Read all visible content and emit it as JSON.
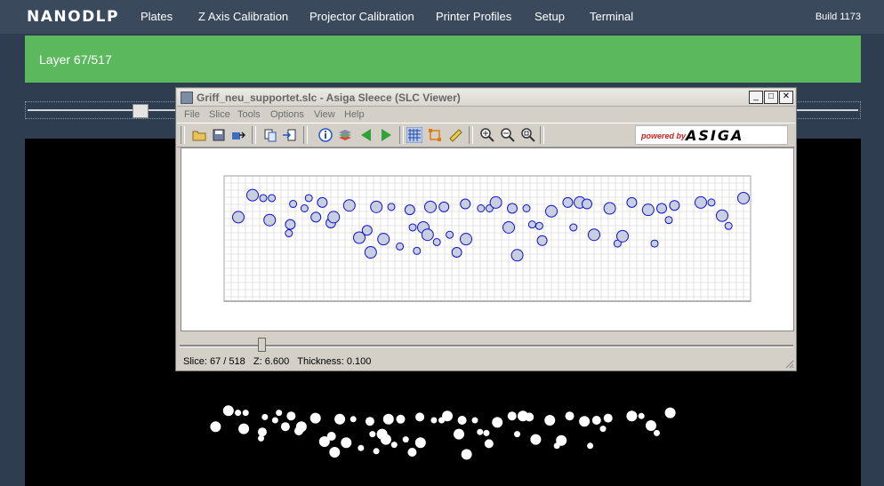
{
  "app": {
    "logo": "NANODLP",
    "build": "Build 1173",
    "nav": [
      "Plates",
      "Z Axis Calibration",
      "Projector Calibration",
      "Printer Profiles",
      "Setup",
      "Terminal"
    ]
  },
  "layer": {
    "label": "Layer 67/517",
    "slider_fraction": 0.13
  },
  "viewer": {
    "title": "Griff_neu_supportet.slc - Asiga Sleece (SLC Viewer)",
    "menu": [
      "File",
      "Slice",
      "Tools",
      "Options",
      "View",
      "Help"
    ],
    "brand_small": "powered by",
    "brand_name": "ASIGA",
    "status_slice": "Slice: 67 / 518",
    "status_z": "Z: 6.600",
    "status_thickness": "Thickness: 0.100",
    "slice_fraction": 0.13,
    "icons": [
      "open-folder-icon",
      "save-icon",
      "export-icon",
      "copy-icon",
      "import-icon",
      "info-icon",
      "layers-icon",
      "prev-slice-icon",
      "next-slice-icon",
      "grid-icon",
      "bounding-box-icon",
      "ruler-icon",
      "zoom-in-icon",
      "zoom-out-icon",
      "zoom-fit-icon"
    ]
  },
  "colors": {
    "topnav": "#3a4a5c",
    "background": "#2e3d4f",
    "layer_bar": "#5cb85c",
    "outline": "#1010cc"
  }
}
